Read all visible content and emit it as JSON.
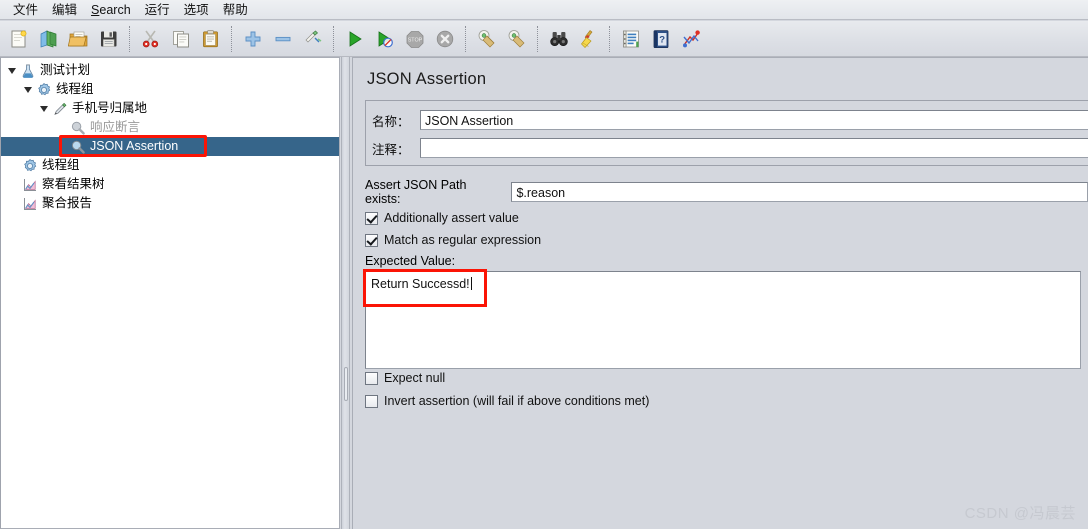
{
  "menu": {
    "items": [
      {
        "label": "文件",
        "mnemonic": ""
      },
      {
        "label": "编辑",
        "mnemonic": ""
      },
      {
        "label": "Search",
        "mnemonic": "S"
      },
      {
        "label": "运行",
        "mnemonic": ""
      },
      {
        "label": "选项",
        "mnemonic": ""
      },
      {
        "label": "帮助",
        "mnemonic": ""
      }
    ]
  },
  "toolbar": {
    "groups": [
      [
        "new-file-icon",
        "new-template-icon",
        "open-folder-icon",
        "save-disk-icon"
      ],
      [
        "cut-scissors-icon",
        "copy-icon",
        "paste-clipboard-icon"
      ],
      [
        "add-plus-icon",
        "remove-minus-icon",
        "toggle-icon"
      ],
      [
        "start-play-icon",
        "start-no-timers-icon",
        "stop-icon",
        "shutdown-icon"
      ],
      [
        "clear-icon",
        "clear-all-icon"
      ],
      [
        "search-binoculars-icon",
        "search-reset-broom-icon"
      ],
      [
        "function-helper-icon",
        "help-book-icon",
        "templates-icon"
      ]
    ]
  },
  "tree": {
    "nodes": [
      {
        "label": "测试计划",
        "icon": "test-plan-icon",
        "depth": 0,
        "expanded": true,
        "selected": false,
        "disabled": false
      },
      {
        "label": "线程组",
        "icon": "thread-group-icon",
        "depth": 1,
        "expanded": true,
        "selected": false,
        "disabled": false
      },
      {
        "label": "手机号归属地",
        "icon": "http-sampler-icon",
        "depth": 2,
        "expanded": true,
        "selected": false,
        "disabled": false
      },
      {
        "label": "响应断言",
        "icon": "assertion-icon",
        "depth": 3,
        "expanded": false,
        "selected": false,
        "disabled": true
      },
      {
        "label": "JSON Assertion",
        "icon": "assertion-icon",
        "depth": 3,
        "expanded": false,
        "selected": true,
        "disabled": false
      },
      {
        "label": "线程组",
        "icon": "thread-group-icon",
        "depth": 1,
        "expanded": false,
        "selected": false,
        "disabled": false
      },
      {
        "label": "察看结果树",
        "icon": "listener-icon",
        "depth": 1,
        "expanded": false,
        "selected": false,
        "disabled": false
      },
      {
        "label": "聚合报告",
        "icon": "listener-icon",
        "depth": 1,
        "expanded": false,
        "selected": false,
        "disabled": false
      }
    ]
  },
  "panel": {
    "title": "JSON Assertion",
    "name_label": "名称：",
    "name_value": "JSON Assertion",
    "comment_label": "注释：",
    "comment_value": "",
    "jsonpath_label": "Assert JSON Path exists:",
    "jsonpath_value": "$.reason",
    "additionally_assert_value_label": "Additionally assert value",
    "additionally_assert_value_checked": true,
    "match_regex_label": "Match as regular expression",
    "match_regex_checked": true,
    "expected_value_label": "Expected Value:",
    "expected_value": "Return Successd!",
    "expect_null_label": "Expect null",
    "expect_null_checked": false,
    "invert_assertion_label": "Invert assertion (will fail if above conditions met)",
    "invert_assertion_checked": false
  },
  "colors": {
    "selection": "#36658a",
    "highlight": "#fb1405",
    "panel_bg": "#d4d7de"
  },
  "watermark": "CSDN @冯晨芸"
}
